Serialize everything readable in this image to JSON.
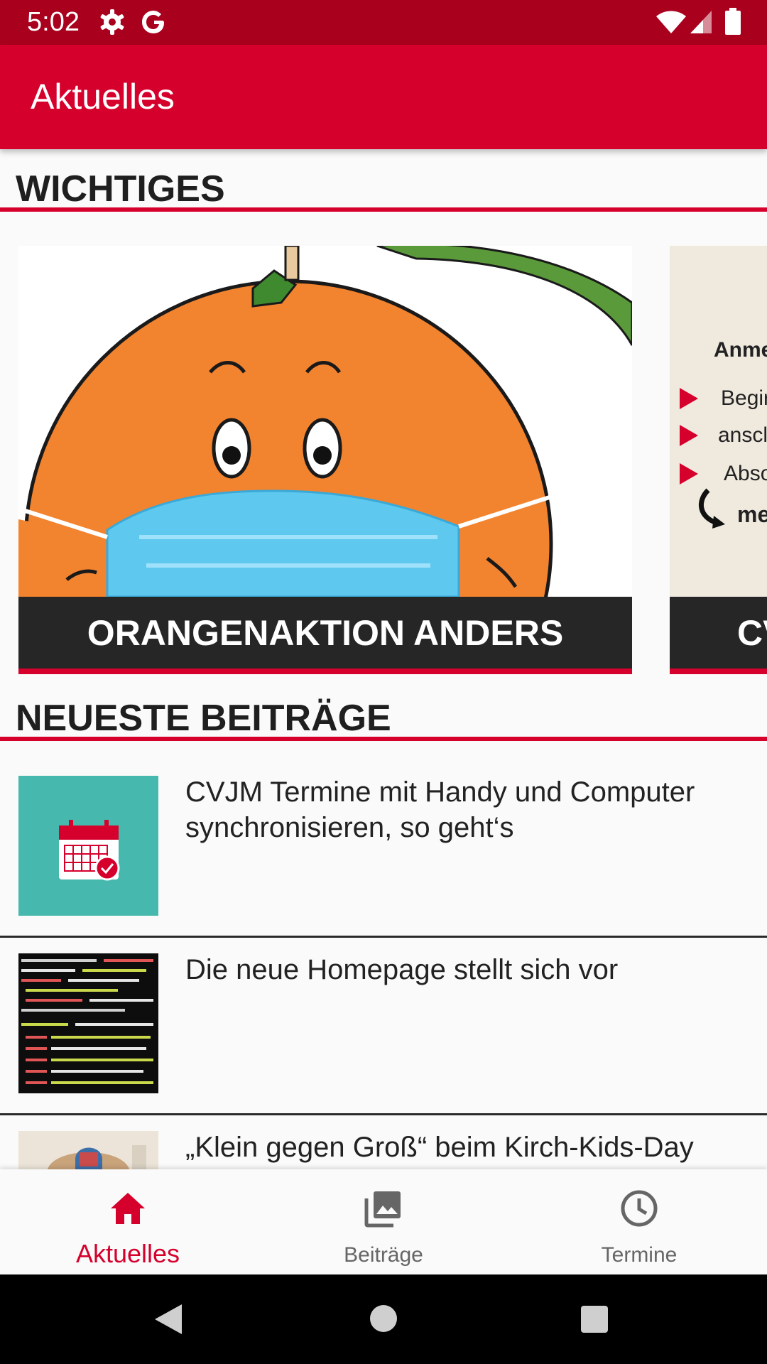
{
  "status_bar": {
    "time": "5:02"
  },
  "app_bar": {
    "title": "Aktuelles"
  },
  "sections": {
    "important": "WICHTIGES",
    "newest": "NEUESTE BEITRÄGE"
  },
  "carousel": {
    "cards": [
      {
        "caption": "ORANGENAKTION ANDERS"
      },
      {
        "caption": "CV",
        "image_text": [
          "Anme",
          "Begir",
          "anscl",
          "Abso",
          "me"
        ]
      }
    ]
  },
  "posts": [
    {
      "title": "CVJM Termine mit Handy und Computer synchronisieren, so geht‘s"
    },
    {
      "title": "Die neue Homepage stellt sich vor"
    },
    {
      "title": "„Klein gegen Groß“ beim Kirch-Kids-Day"
    }
  ],
  "bottom_nav": {
    "items": [
      {
        "label": "Aktuelles",
        "icon": "home-icon",
        "active": true
      },
      {
        "label": "Beiträge",
        "icon": "photo-library-icon",
        "active": false
      },
      {
        "label": "Termine",
        "icon": "clock-icon",
        "active": false
      }
    ]
  },
  "colors": {
    "primary": "#d6002c",
    "status_bar": "#a8001d",
    "caption_bg": "#262626"
  }
}
